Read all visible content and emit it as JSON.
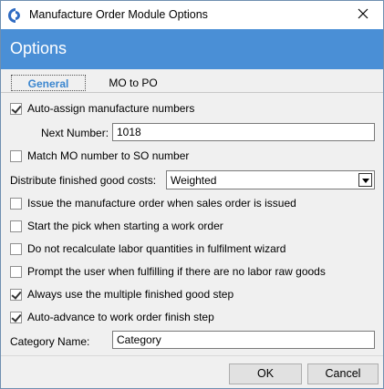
{
  "window": {
    "title": "Manufacture Order Module Options"
  },
  "banner": {
    "title": "Options"
  },
  "tabs": [
    {
      "label": "General",
      "active": true
    },
    {
      "label": "MO to PO",
      "active": false
    }
  ],
  "general": {
    "auto_assign": {
      "label": "Auto-assign manufacture numbers",
      "checked": true
    },
    "next_number": {
      "label": "Next Number:",
      "value": "1018"
    },
    "match_mo": {
      "label": "Match MO number to SO number",
      "checked": false
    },
    "distribute": {
      "label": "Distribute finished good costs:",
      "value": "Weighted"
    },
    "issue_mo": {
      "label": "Issue the manufacture order when sales order is issued",
      "checked": false
    },
    "start_pick": {
      "label": "Start the pick when starting a work order",
      "checked": false
    },
    "no_recalc": {
      "label": "Do not recalculate labor quantities in fulfilment wizard",
      "checked": false
    },
    "prompt_user": {
      "label": "Prompt the user when fulfilling if there are no labor raw goods",
      "checked": false
    },
    "multi_fg": {
      "label": "Always use the multiple finished good step",
      "checked": true
    },
    "auto_advance": {
      "label": "Auto-advance to work order finish step",
      "checked": true
    },
    "category": {
      "label": "Category Name:",
      "value": "Category"
    }
  },
  "footer": {
    "ok_label": "OK",
    "cancel_label": "Cancel"
  },
  "colors": {
    "banner": "#4a8fd6",
    "active_tab": "#3b86cf"
  },
  "icons": {
    "app": "app-logo-icon",
    "close": "close-icon",
    "dropdown": "chevron-down-icon"
  }
}
